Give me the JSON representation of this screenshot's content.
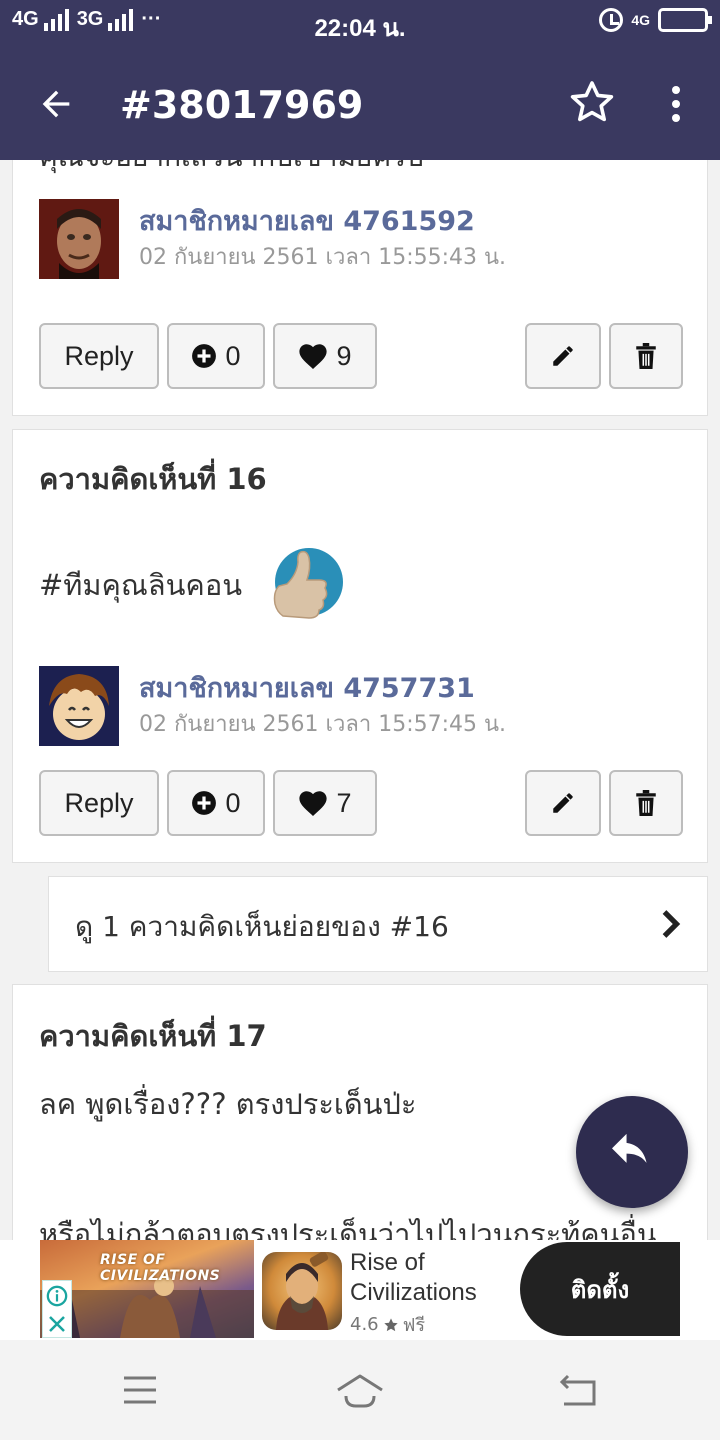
{
  "status_bar": {
    "network1": "4G",
    "network2": "3G",
    "more": "···",
    "time": "22:04 น.",
    "network_right": "4G"
  },
  "app_bar": {
    "title": "#38017969"
  },
  "comments": [
    {
      "partial_text": "คุณจะอยากเสวนากับเขามั้ยครับ",
      "author": "สมาชิกหมายเลข 4761592",
      "date": "02 กันยายน 2561 เวลา 15:55:43 น.",
      "reply_label": "Reply",
      "plus_count": "0",
      "heart_count": "9"
    },
    {
      "title": "ความคิดเห็นที่ 16",
      "body": "#ทีมคุณลินคอน",
      "author": "สมาชิกหมายเลข 4757731",
      "date": "02 กันยายน 2561 เวลา 15:57:45 น.",
      "reply_label": "Reply",
      "plus_count": "0",
      "heart_count": "7"
    },
    {
      "title": "ความคิดเห็นที่ 17",
      "body_line1": "ลค พูดเรื่อง??? ตรงประเด็นป่ะ",
      "body_line2": "หรือไม่กล้าตอบตรงประเด็นว่าไปไปวนกระทู้คนอื่น"
    }
  ],
  "subcomments_link": "ดู 1 ความคิดเห็นย่อยของ #16",
  "ad": {
    "banner_text": "RISE OF CIVILIZATIONS",
    "app_name": "Rise of Civilizations",
    "rating": "4.6",
    "price": "ฟรี",
    "install_label": "ติดตั้ง"
  },
  "icons": {
    "back": "arrow-left-icon",
    "star": "star-outline-icon",
    "menu": "more-vert-icon",
    "plus": "plus-circle-icon",
    "heart": "heart-icon",
    "edit": "pencil-icon",
    "delete": "trash-icon",
    "chevron": "chevron-right-icon",
    "fab": "reply-icon"
  },
  "colors": {
    "primary": "#3a3960",
    "fab": "#2e2c4f",
    "author": "#5a6a9a"
  }
}
